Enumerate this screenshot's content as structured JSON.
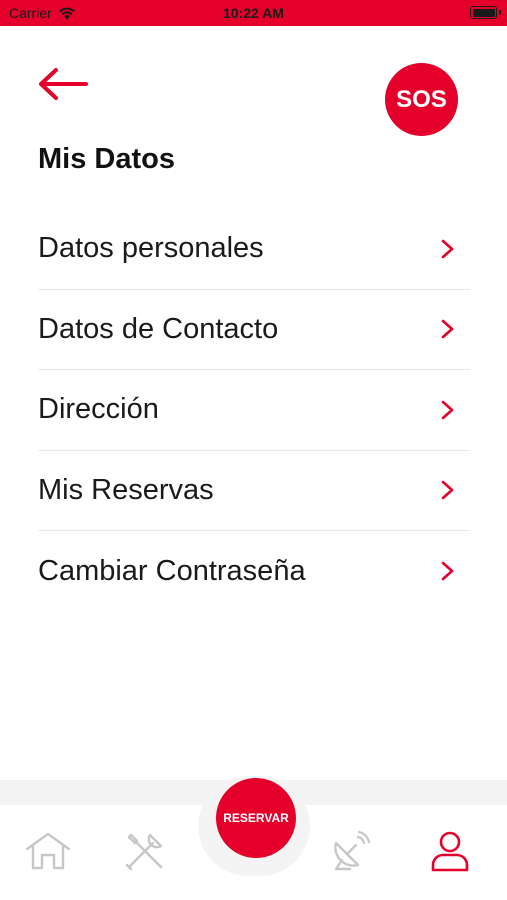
{
  "status_bar": {
    "carrier": "Carrier",
    "time": "10:22 AM"
  },
  "header": {
    "sos_label": "SOS",
    "title": "Mis Datos"
  },
  "menu": {
    "items": [
      {
        "label": "Datos personales"
      },
      {
        "label": "Datos de Contacto"
      },
      {
        "label": "Dirección"
      },
      {
        "label": "Mis Reservas"
      },
      {
        "label": "Cambiar Contraseña"
      }
    ]
  },
  "tab_bar": {
    "reservar_label": "RESERVAR",
    "tabs": [
      "home-icon",
      "tools-icon",
      "satellite-dish-icon",
      "user-icon"
    ],
    "active_tab": "user-icon"
  },
  "colors": {
    "accent": "#e4002b",
    "inactive_icon": "#c7c7c7"
  }
}
